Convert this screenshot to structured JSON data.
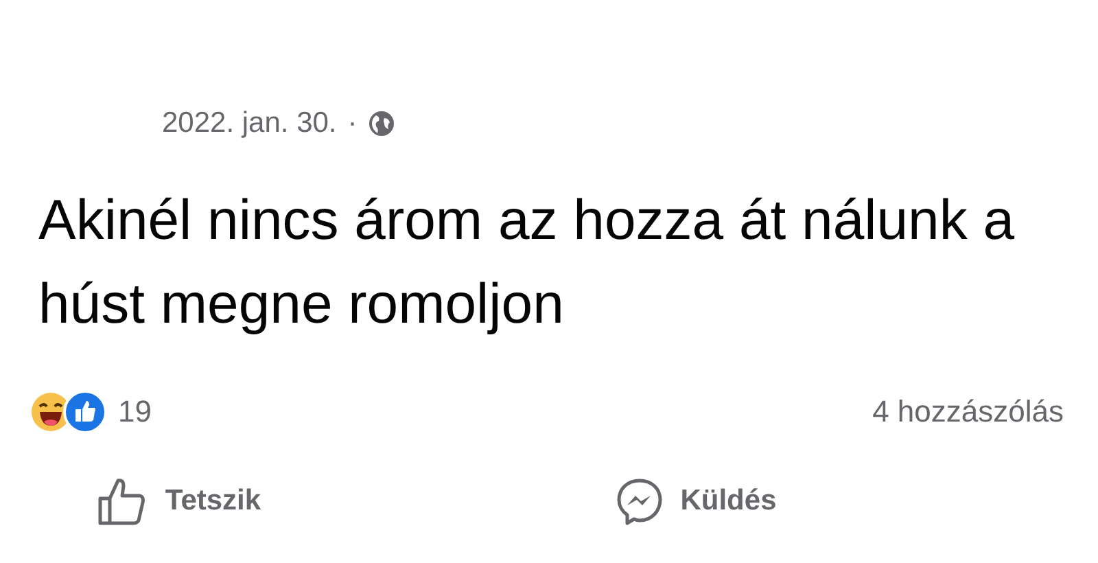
{
  "post": {
    "date": "2022. jan. 30.",
    "separator": "·",
    "text": "Akinél nincs árom az hozza át nálunk a húst megne romoljon"
  },
  "reactions": {
    "count": "19"
  },
  "comments": "4 hozzászólás",
  "actions": [
    {
      "kind": "like",
      "label": "Tetszik"
    },
    {
      "kind": "send",
      "label": "Küldés"
    }
  ]
}
